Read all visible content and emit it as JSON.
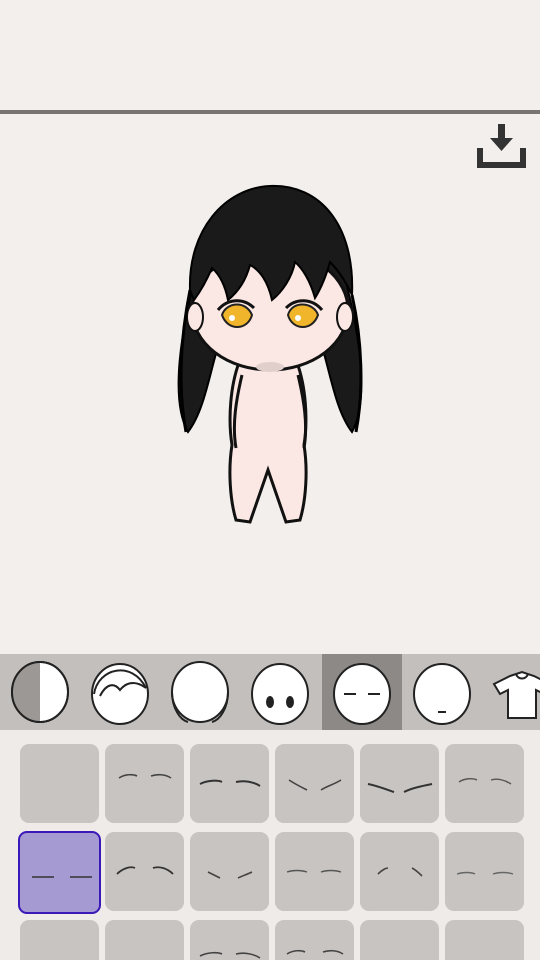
{
  "toolbar": {
    "download_icon": "download-icon"
  },
  "categories": [
    {
      "name": "face-shape",
      "icon": "half-shaded-head-icon",
      "selected": false
    },
    {
      "name": "hair",
      "icon": "hair-outline-icon",
      "selected": false
    },
    {
      "name": "back-hair",
      "icon": "back-hair-icon",
      "selected": false
    },
    {
      "name": "eyes",
      "icon": "eyes-face-icon",
      "selected": false
    },
    {
      "name": "eyebrows",
      "icon": "eyebrows-face-icon",
      "selected": true
    },
    {
      "name": "mouth",
      "icon": "mouth-face-icon",
      "selected": false
    },
    {
      "name": "clothes",
      "icon": "tshirt-icon",
      "selected": false
    }
  ],
  "eyebrow_options": {
    "selected_index": 6,
    "count_visible": 18
  },
  "colors": {
    "background": "#f3efec",
    "category_bar": "#c3bfbc",
    "selected_tab": "#8c8987",
    "option_cell": "#c8c4c2",
    "selected_cell_fill": "#a69ad3",
    "selected_cell_border": "#3a19b8",
    "hair": "#1b1a1a",
    "skin": "#fbe7e3",
    "eyes": "#f0b52a"
  }
}
